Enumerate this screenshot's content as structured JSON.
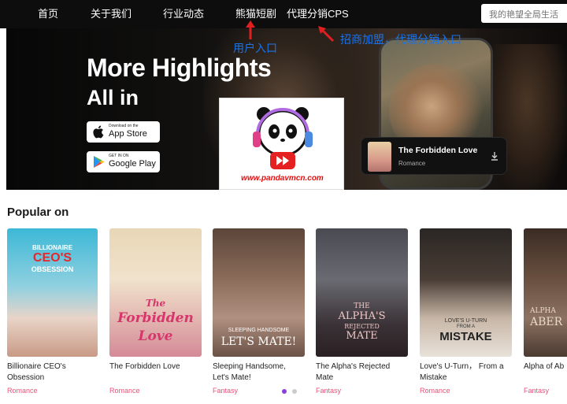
{
  "nav": {
    "items": [
      {
        "label": "首页"
      },
      {
        "label": "关于我们"
      },
      {
        "label": "行业动态"
      },
      {
        "label": "熊猫短剧"
      },
      {
        "label": "代理分销CPS"
      }
    ],
    "search_placeholder": "我的艳望全局生活"
  },
  "hero": {
    "title_line1": "More Highlights",
    "title_line2": "All in",
    "app_store": {
      "small": "Download on the",
      "big": "App Store"
    },
    "google_play": {
      "small": "GET IN ON",
      "big": "Google Play"
    },
    "featured": {
      "title": "The Forbidden Love",
      "genre": "Romance"
    }
  },
  "logo": {
    "url_text": "www.pandavmcn.com"
  },
  "annotations": {
    "user_entry": "用户入口",
    "agent_entry": "招商加盟，代理分销入口"
  },
  "popular": {
    "title": "Popular on",
    "books": [
      {
        "title": "Billionaire CEO's Obsession",
        "genre": "Romance",
        "cover_text": [
          "BILLIONAIRE",
          "CEO'S",
          "OBSESSION"
        ]
      },
      {
        "title": "The Forbidden Love",
        "genre": "Romance",
        "cover_text": [
          "The",
          "Forbidden",
          "Love"
        ]
      },
      {
        "title": "Sleeping Handsome, Let's Mate!",
        "genre": "Fantasy",
        "cover_text": [
          "SLEEPING HANDSOME",
          "LET'S MATE!"
        ]
      },
      {
        "title": "The Alpha's Rejected Mate",
        "genre": "Fantasy",
        "cover_text": [
          "THE",
          "ALPHA'S",
          "REJECTED",
          "MATE"
        ]
      },
      {
        "title": "Love's U-Turn， From a Mistake",
        "genre": "Romance",
        "cover_text": [
          "LOVE'S U-TURN",
          "FROM A",
          "MISTAKE"
        ]
      },
      {
        "title": "Alpha of Ab",
        "genre": "Fantasy",
        "cover_text": [
          "ALPHA",
          "ABER"
        ]
      }
    ],
    "pagination": {
      "active_color": "#8b3fd9",
      "inactive_color": "#cccccc"
    }
  },
  "colors": {
    "nav_bg": "#0d0d0d",
    "annotation_blue": "#1a73e8",
    "genre_pink": "#e8527a",
    "arrow_red": "#e02020",
    "logo_red": "#e01010"
  }
}
